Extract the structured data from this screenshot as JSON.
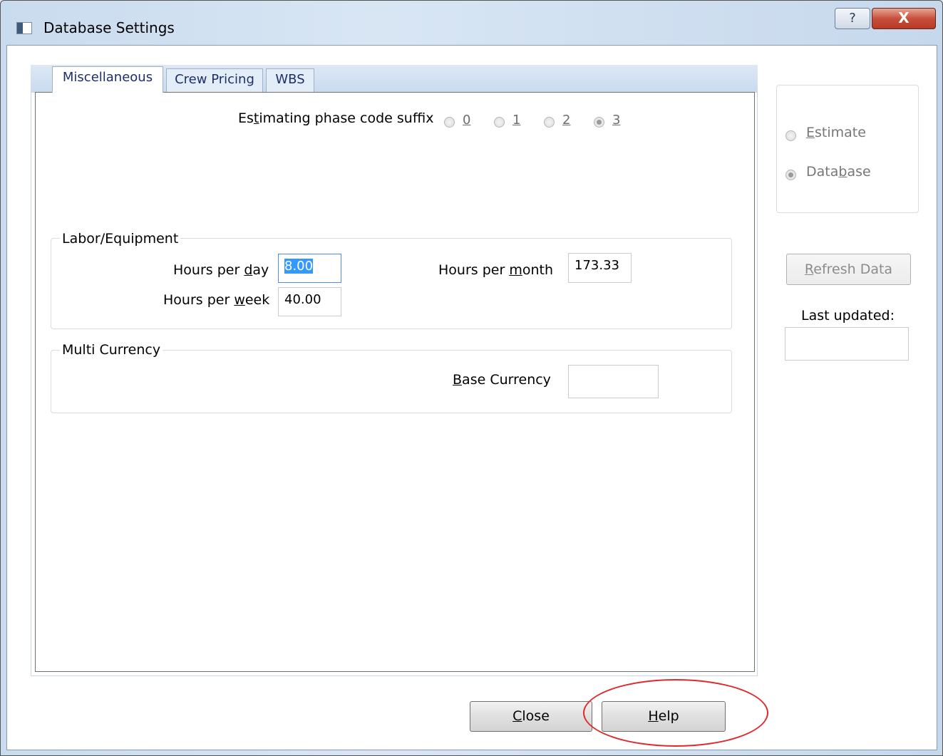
{
  "window": {
    "title": "Database Settings",
    "help_glyph": "?",
    "close_glyph": "X"
  },
  "tabs": [
    {
      "label": "Miscellaneous",
      "active": true
    },
    {
      "label": "Crew Pricing",
      "active": false
    },
    {
      "label": "WBS",
      "active": false
    }
  ],
  "phase_code": {
    "label_pre": "Es",
    "label_ul": "t",
    "label_post": "imating phase code suffix",
    "options": [
      "0",
      "1",
      "2",
      "3"
    ],
    "selected": "3"
  },
  "labor_equipment": {
    "group_title": "Labor/Equipment",
    "hours_per_day": {
      "label_pre": "Hours per ",
      "label_ul": "d",
      "label_post": "ay",
      "value": "8.00"
    },
    "hours_per_week": {
      "label_pre": "Hours per ",
      "label_ul": "w",
      "label_post": "eek",
      "value": "40.00"
    },
    "hours_per_month": {
      "label_pre": "Hours per ",
      "label_ul": "m",
      "label_post": "onth",
      "value": "173.33"
    }
  },
  "multi_currency": {
    "group_title": "Multi Currency",
    "base_currency": {
      "label_ul": "B",
      "label_post": "ase Currency",
      "value": ""
    }
  },
  "source": {
    "options": [
      {
        "label_ul_pre": "",
        "label_ul": "E",
        "label_post": "stimate",
        "selected": false
      },
      {
        "label_ul_pre": "Data",
        "label_ul": "b",
        "label_post": "ase",
        "selected": true
      }
    ]
  },
  "refresh": {
    "label_ul": "R",
    "label_post": "efresh Data",
    "enabled": false
  },
  "last_updated": {
    "label": "Last updated:",
    "value": ""
  },
  "footer": {
    "close": {
      "label_ul": "C",
      "label_post": "lose"
    },
    "help": {
      "label_ul": "H",
      "label_post": "elp"
    }
  },
  "colors": {
    "annotation": "#e0282b",
    "selection": "#3399ff",
    "tab_text": "#1d2f6b"
  }
}
